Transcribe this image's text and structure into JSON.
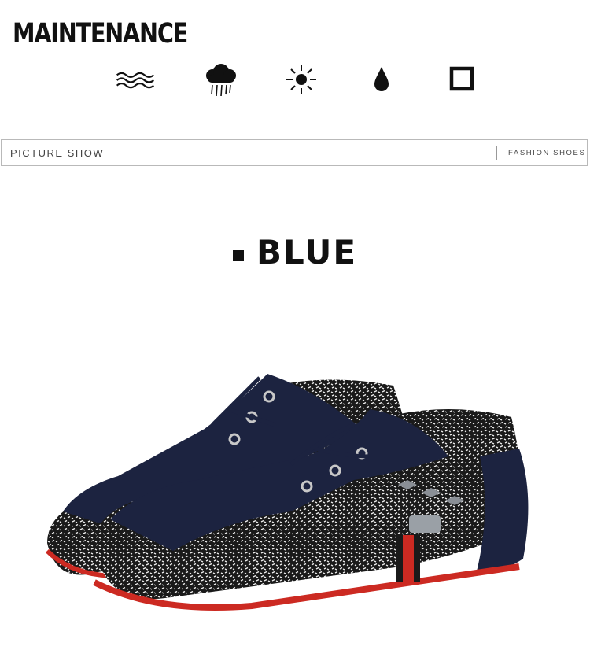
{
  "maintenance": {
    "title": "MAINTENANCE",
    "icons": [
      "wash-icon",
      "rain-cloud-icon",
      "sun-icon",
      "water-drop-icon",
      "square-icon"
    ]
  },
  "picture_bar": {
    "label": "PICTURE SHOW",
    "right_label": "FASHION SHOES"
  },
  "color_section": {
    "label": "BLUE",
    "image": "navy-blue-suede-lace-up-loafer-shoes-photo"
  },
  "colors": {
    "text": "#111111",
    "shoe_suede": "#1c2340",
    "shoe_sole": "#cc2a22",
    "border": "#b9b9b9"
  }
}
